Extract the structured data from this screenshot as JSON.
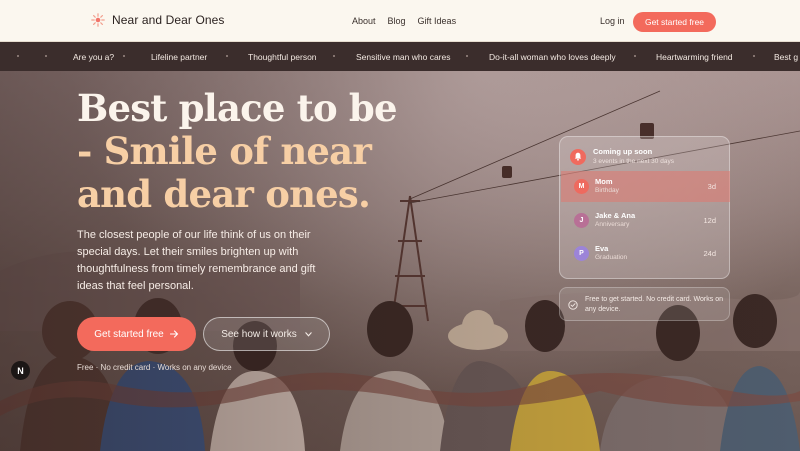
{
  "header": {
    "brand": "Near and Dear Ones",
    "nav": [
      "About",
      "Blog",
      "Gift Ideas"
    ],
    "login": "Log in",
    "cta": "Get started free"
  },
  "ticker": {
    "items": [
      "Are you a?",
      "Lifeline partner",
      "Thoughtful person",
      "Sensitive man who cares",
      "Do-it-all woman who loves deeply",
      "Heartwarming friend",
      "Best g"
    ]
  },
  "hero": {
    "headline_line1": "Best place to be",
    "headline_accent_1": "- Smile of near",
    "headline_accent_2": "and dear ones.",
    "subtext": "The closest people of our life think of us on their special days. Let their smiles brighten up with thoughtfulness from timely remembrance and gift ideas that feel personal.",
    "primary_button": "Get started free",
    "secondary_button": "See how it works",
    "fine_print": "Free · No credit card · Works on any device"
  },
  "events_card": {
    "title": "Coming up soon",
    "subtitle": "3 events in the next 30 days",
    "events": [
      {
        "initial": "M",
        "name": "Mom",
        "type": "Birthday",
        "days": "3d",
        "color": "#ee6a5f"
      },
      {
        "initial": "J",
        "name": "Jake & Ana",
        "type": "Anniversary",
        "days": "12d",
        "color": "#b87096"
      },
      {
        "initial": "P",
        "name": "Eva",
        "type": "Graduation",
        "days": "24d",
        "color": "#9c84d8"
      }
    ]
  },
  "note": {
    "text": "Free to get started. No credit card. Works on any device."
  },
  "badge": "N",
  "colors": {
    "accent": "#f36a5c",
    "headline_accent": "#f7cfa5",
    "ticker_bg": "#3b2d2c",
    "header_bg": "#fbf7ef"
  }
}
